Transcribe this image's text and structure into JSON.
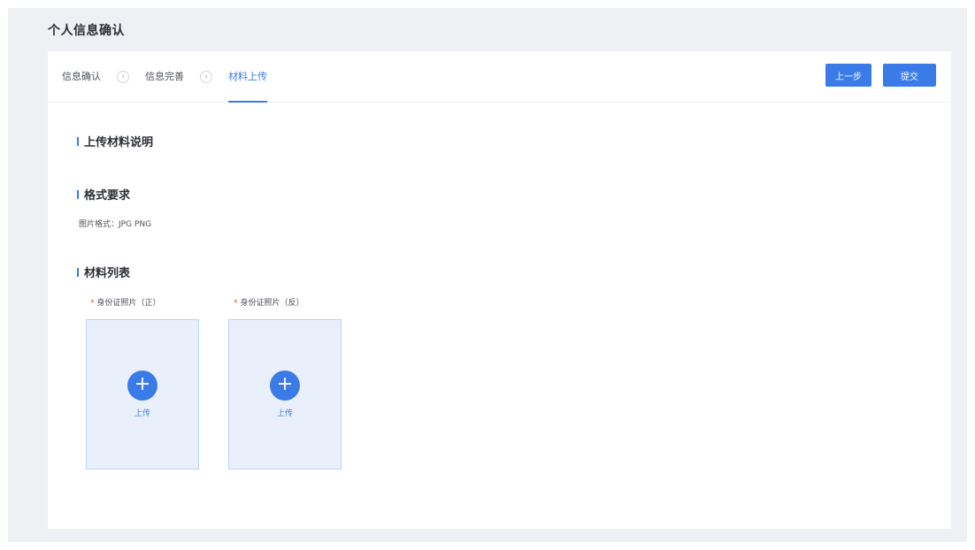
{
  "page": {
    "title": "个人信息确认"
  },
  "steps": [
    {
      "label": "信息确认"
    },
    {
      "label": "信息完善"
    },
    {
      "label": "材料上传"
    }
  ],
  "step_separator_glyph": "›",
  "buttons": {
    "prev": "上一步",
    "submit": "提交"
  },
  "sections": {
    "upload_desc": "上传材料说明",
    "format_req": "格式要求",
    "format_text": "图片格式：JPG PNG",
    "material_list": "材料列表"
  },
  "uploads": [
    {
      "required_mark": "*",
      "label": "身份证照片（正）",
      "button_text": "上传",
      "icon": "plus-icon"
    },
    {
      "required_mark": "*",
      "label": "身份证照片（反）",
      "button_text": "上传",
      "icon": "plus-icon"
    }
  ],
  "colors": {
    "accent": "#3a7be8",
    "background": "#eef0f3",
    "upload_bg": "#e9f0fb",
    "required": "#f04b4b"
  }
}
